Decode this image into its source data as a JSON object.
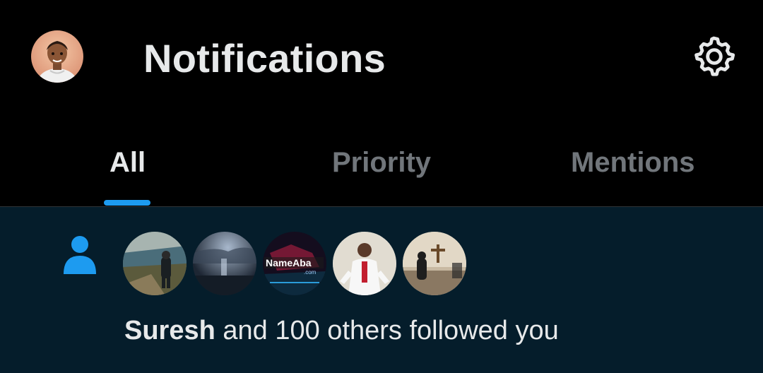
{
  "header": {
    "title": "Notifications",
    "avatar_icon": "profile-avatar",
    "settings_icon": "gear-icon"
  },
  "tabs": [
    {
      "label": "All",
      "selected": true
    },
    {
      "label": "Priority",
      "selected": false
    },
    {
      "label": "Mentions",
      "selected": false
    }
  ],
  "notification": {
    "icon": "person-icon",
    "follower_avatar_count": 5,
    "user": "Suresh",
    "text": "and 100 others followed you"
  },
  "colors": {
    "background": "#000000",
    "notification_bg": "#051d2b",
    "accent": "#1d9bf0",
    "text_primary": "#e7e9ea",
    "text_secondary": "#71767b"
  }
}
